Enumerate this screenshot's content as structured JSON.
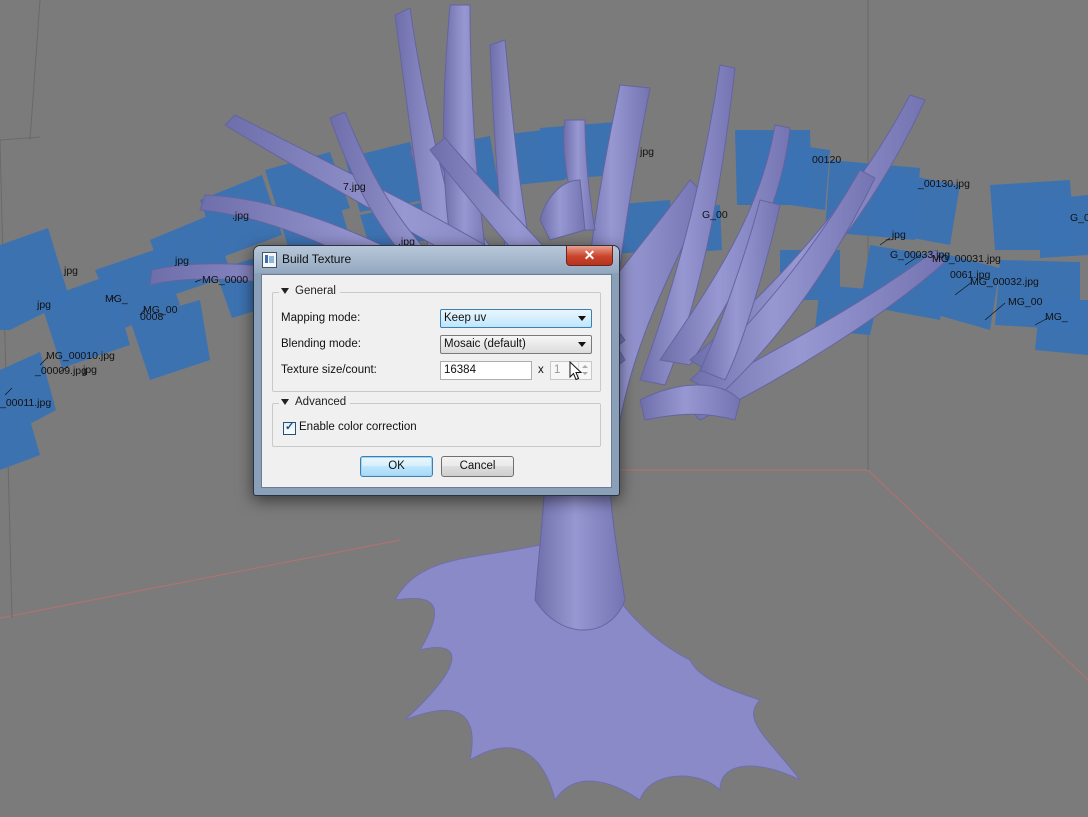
{
  "viewport": {
    "camera_labels": [
      "_00011.jpg",
      "MG_00010.jpg",
      "_00009.jpg",
      "jpg",
      "jpg",
      "jpg",
      "MG_",
      "MG_00",
      "0008",
      "MG_0000",
      "jpg",
      "7.jpg",
      ".jpg",
      ".jpg",
      "jpg",
      "G_00",
      "00120",
      "_00130.jpg",
      "G_0",
      "_jpg",
      "G_00033.jpg",
      "MG_00032.jpg",
      "0061.jpg",
      "MG_00031.jpg",
      "MG_00",
      "MG_"
    ]
  },
  "dialog": {
    "title": "Build Texture",
    "close_label": "✕",
    "general": {
      "header": "General",
      "mapping_mode_label": "Mapping mode:",
      "mapping_mode_value": "Keep uv",
      "blending_mode_label": "Blending mode:",
      "blending_mode_value": "Mosaic (default)",
      "texture_size_label": "Texture size/count:",
      "texture_size_value": "16384",
      "times_symbol": "x",
      "texture_count_value": "1"
    },
    "advanced": {
      "header": "Advanced",
      "color_correction_label": "Enable color correction",
      "color_correction_checked": true
    },
    "ok_label": "OK",
    "cancel_label": "Cancel"
  },
  "colors": {
    "background": "#7a7a7a",
    "camera_blue": "#3a72b4",
    "mesh": "#8c8cc8"
  }
}
